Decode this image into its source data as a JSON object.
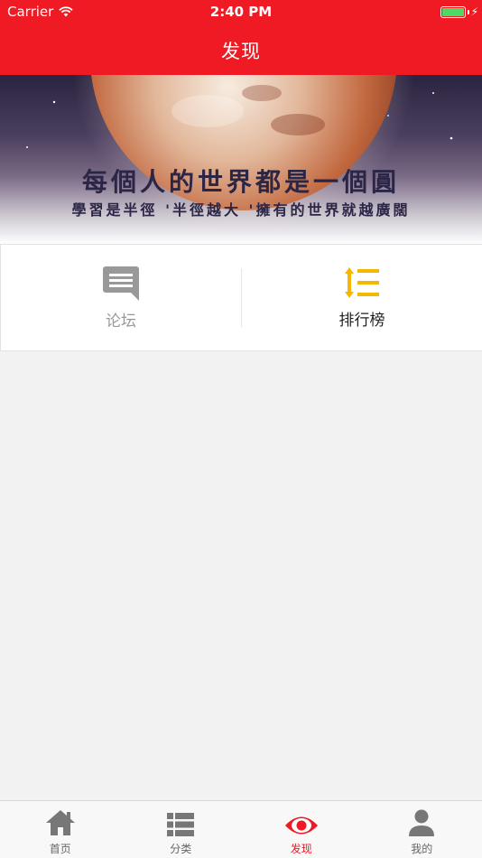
{
  "status": {
    "carrier": "Carrier",
    "time": "2:40 PM"
  },
  "nav": {
    "title": "发现"
  },
  "banner": {
    "line1": "每個人的世界都是一個圓",
    "line2": "學習是半徑 '半徑越大 '擁有的世界就越廣闊"
  },
  "entries": [
    {
      "label": "论坛",
      "icon": "forum-icon",
      "color": "#999999"
    },
    {
      "label": "排行榜",
      "icon": "ranking-icon",
      "color": "#f5b800"
    }
  ],
  "tabs": [
    {
      "label": "首页",
      "icon": "home-icon",
      "active": false
    },
    {
      "label": "分类",
      "icon": "category-list-icon",
      "active": false
    },
    {
      "label": "发现",
      "icon": "eye-icon",
      "active": true
    },
    {
      "label": "我的",
      "icon": "user-icon",
      "active": false
    }
  ],
  "colors": {
    "brand": "#ef1a23",
    "accent": "#f5b800",
    "inactive": "#777777"
  }
}
